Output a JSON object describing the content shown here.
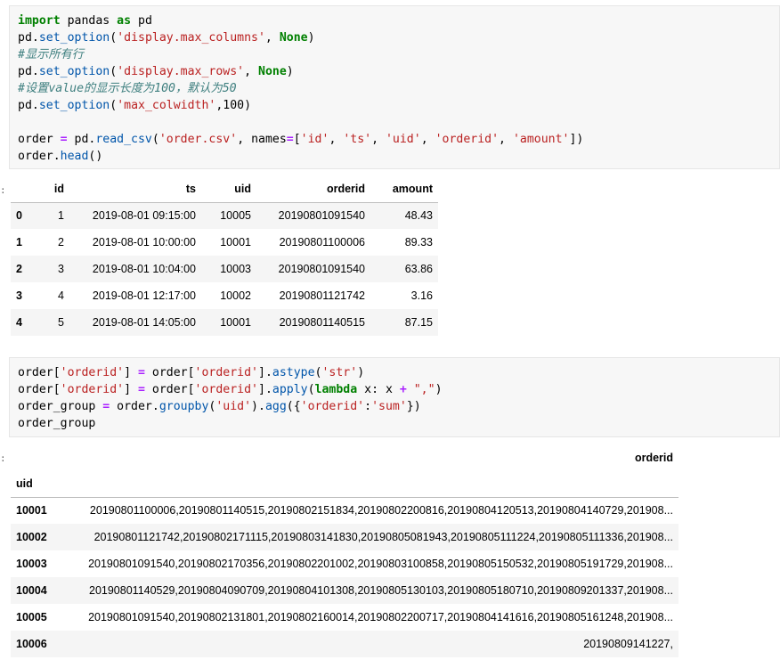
{
  "cell1": {
    "lines": [
      [
        [
          "kw",
          "import"
        ],
        [
          "",
          " pandas "
        ],
        [
          "kw",
          "as"
        ],
        [
          "",
          " pd"
        ]
      ],
      [
        [
          "",
          "pd."
        ],
        [
          "fn",
          "set_option"
        ],
        [
          "",
          "("
        ],
        [
          "str",
          "'display.max_columns'"
        ],
        [
          "",
          ", "
        ],
        [
          "kw",
          "None"
        ],
        [
          "",
          ")"
        ]
      ],
      [
        [
          "com",
          "#显示所有行"
        ]
      ],
      [
        [
          "",
          "pd."
        ],
        [
          "fn",
          "set_option"
        ],
        [
          "",
          "("
        ],
        [
          "str",
          "'display.max_rows'"
        ],
        [
          "",
          ", "
        ],
        [
          "kw",
          "None"
        ],
        [
          "",
          ")"
        ]
      ],
      [
        [
          "com",
          "#设置value的显示长度为100，默认为50"
        ]
      ],
      [
        [
          "",
          "pd."
        ],
        [
          "fn",
          "set_option"
        ],
        [
          "",
          "("
        ],
        [
          "str",
          "'max_colwidth'"
        ],
        [
          "",
          ",100)"
        ]
      ],
      [
        [
          "",
          ""
        ]
      ],
      [
        [
          "",
          "order "
        ],
        [
          "op",
          "="
        ],
        [
          "",
          " pd."
        ],
        [
          "fn",
          "read_csv"
        ],
        [
          "",
          "("
        ],
        [
          "str",
          "'order.csv'"
        ],
        [
          "",
          ", names"
        ],
        [
          "op",
          "="
        ],
        [
          "",
          "["
        ],
        [
          "str",
          "'id'"
        ],
        [
          "",
          ", "
        ],
        [
          "str",
          "'ts'"
        ],
        [
          "",
          ", "
        ],
        [
          "str",
          "'uid'"
        ],
        [
          "",
          ", "
        ],
        [
          "str",
          "'orderid'"
        ],
        [
          "",
          ", "
        ],
        [
          "str",
          "'amount'"
        ],
        [
          "",
          "])"
        ]
      ],
      [
        [
          "",
          "order."
        ],
        [
          "fn",
          "head"
        ],
        [
          "",
          "()"
        ]
      ]
    ]
  },
  "out1": {
    "columns": [
      "",
      "id",
      "ts",
      "uid",
      "orderid",
      "amount"
    ],
    "rows": [
      [
        "0",
        "1",
        "2019-08-01 09:15:00",
        "10005",
        "20190801091540",
        "48.43"
      ],
      [
        "1",
        "2",
        "2019-08-01 10:00:00",
        "10001",
        "20190801100006",
        "89.33"
      ],
      [
        "2",
        "3",
        "2019-08-01 10:04:00",
        "10003",
        "20190801091540",
        "63.86"
      ],
      [
        "3",
        "4",
        "2019-08-01 12:17:00",
        "10002",
        "20190801121742",
        "3.16"
      ],
      [
        "4",
        "5",
        "2019-08-01 14:05:00",
        "10001",
        "20190801140515",
        "87.15"
      ]
    ]
  },
  "cell2": {
    "lines": [
      [
        [
          "",
          "order["
        ],
        [
          "str",
          "'orderid'"
        ],
        [
          "",
          "] "
        ],
        [
          "op",
          "="
        ],
        [
          "",
          " order["
        ],
        [
          "str",
          "'orderid'"
        ],
        [
          "",
          "]."
        ],
        [
          "fn",
          "astype"
        ],
        [
          "",
          "("
        ],
        [
          "str",
          "'str'"
        ],
        [
          "",
          ")"
        ]
      ],
      [
        [
          "",
          "order["
        ],
        [
          "str",
          "'orderid'"
        ],
        [
          "",
          "] "
        ],
        [
          "op",
          "="
        ],
        [
          "",
          " order["
        ],
        [
          "str",
          "'orderid'"
        ],
        [
          "",
          "]."
        ],
        [
          "fn",
          "apply"
        ],
        [
          "",
          "("
        ],
        [
          "kw",
          "lambda"
        ],
        [
          "",
          " x: x "
        ],
        [
          "op",
          "+"
        ],
        [
          "",
          " "
        ],
        [
          "str",
          "\",\""
        ],
        [
          "",
          ")"
        ]
      ],
      [
        [
          "",
          "order_group "
        ],
        [
          "op",
          "="
        ],
        [
          "",
          " order."
        ],
        [
          "fn",
          "groupby"
        ],
        [
          "",
          "("
        ],
        [
          "str",
          "'uid'"
        ],
        [
          "",
          ")."
        ],
        [
          "fn",
          "agg"
        ],
        [
          "",
          "({"
        ],
        [
          "str",
          "'orderid'"
        ],
        [
          "",
          ":"
        ],
        [
          "str",
          "'sum'"
        ],
        [
          "",
          "})"
        ]
      ],
      [
        [
          "",
          "order_group"
        ]
      ]
    ]
  },
  "out2": {
    "column": "orderid",
    "index_name": "uid",
    "rows": [
      [
        "10001",
        "20190801100006,20190801140515,20190802151834,20190802200816,20190804120513,20190804140729,201908..."
      ],
      [
        "10002",
        "20190801121742,20190802171115,20190803141830,20190805081943,20190805111224,20190805111336,201908..."
      ],
      [
        "10003",
        "20190801091540,20190802170356,20190802201002,20190803100858,20190805150532,20190805191729,201908..."
      ],
      [
        "10004",
        "20190801140529,20190804090709,20190804101308,20190805130103,20190805180710,20190809201337,201908..."
      ],
      [
        "10005",
        "20190801091540,20190802131801,20190802160014,20190802200717,20190804141616,20190805161248,201908..."
      ],
      [
        "10006",
        "20190809141227,"
      ]
    ]
  },
  "prompt_char": ":"
}
